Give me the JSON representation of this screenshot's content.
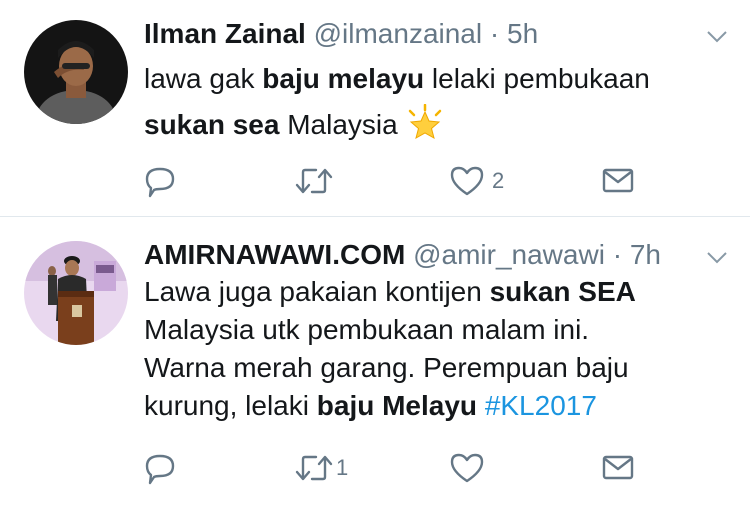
{
  "tweets": [
    {
      "display_name": "Ilman Zainal",
      "handle": "@ilmanzainal",
      "separator": "·",
      "time": "5h",
      "body": {
        "l1a": "lawa gak ",
        "l1b": "baju melayu",
        "l1c": " lelaki pembukaan",
        "l2a": "sukan sea",
        "l2b": " Malaysia ",
        "emoji": "glowing-star-emoji"
      },
      "actions": {
        "reply_count": "",
        "retweet_count": "",
        "like_count": "2"
      }
    },
    {
      "display_name": "AMIRNAWAWI.COM",
      "handle": "@amir_nawawi",
      "separator": "·",
      "time": "7h",
      "body": {
        "l1a": "Lawa juga pakaian kontijen ",
        "l1b": "sukan SEA",
        "l2": "Malaysia utk pembukaan malam ini.",
        "l3": "Warna merah garang. Perempuan baju",
        "l4a": "kurung, lelaki ",
        "l4b": "baju Melayu",
        "l4c": " ",
        "hashtag": "#KL2017"
      },
      "actions": {
        "reply_count": "",
        "retweet_count": "1",
        "like_count": ""
      }
    }
  ],
  "icons": [
    "chevron-down-icon",
    "reply-icon",
    "retweet-icon",
    "like-icon",
    "direct-message-icon"
  ],
  "colors": {
    "text": "#14171a",
    "muted": "#657786",
    "link": "#1b95e0",
    "divider": "#e1e8ed"
  }
}
